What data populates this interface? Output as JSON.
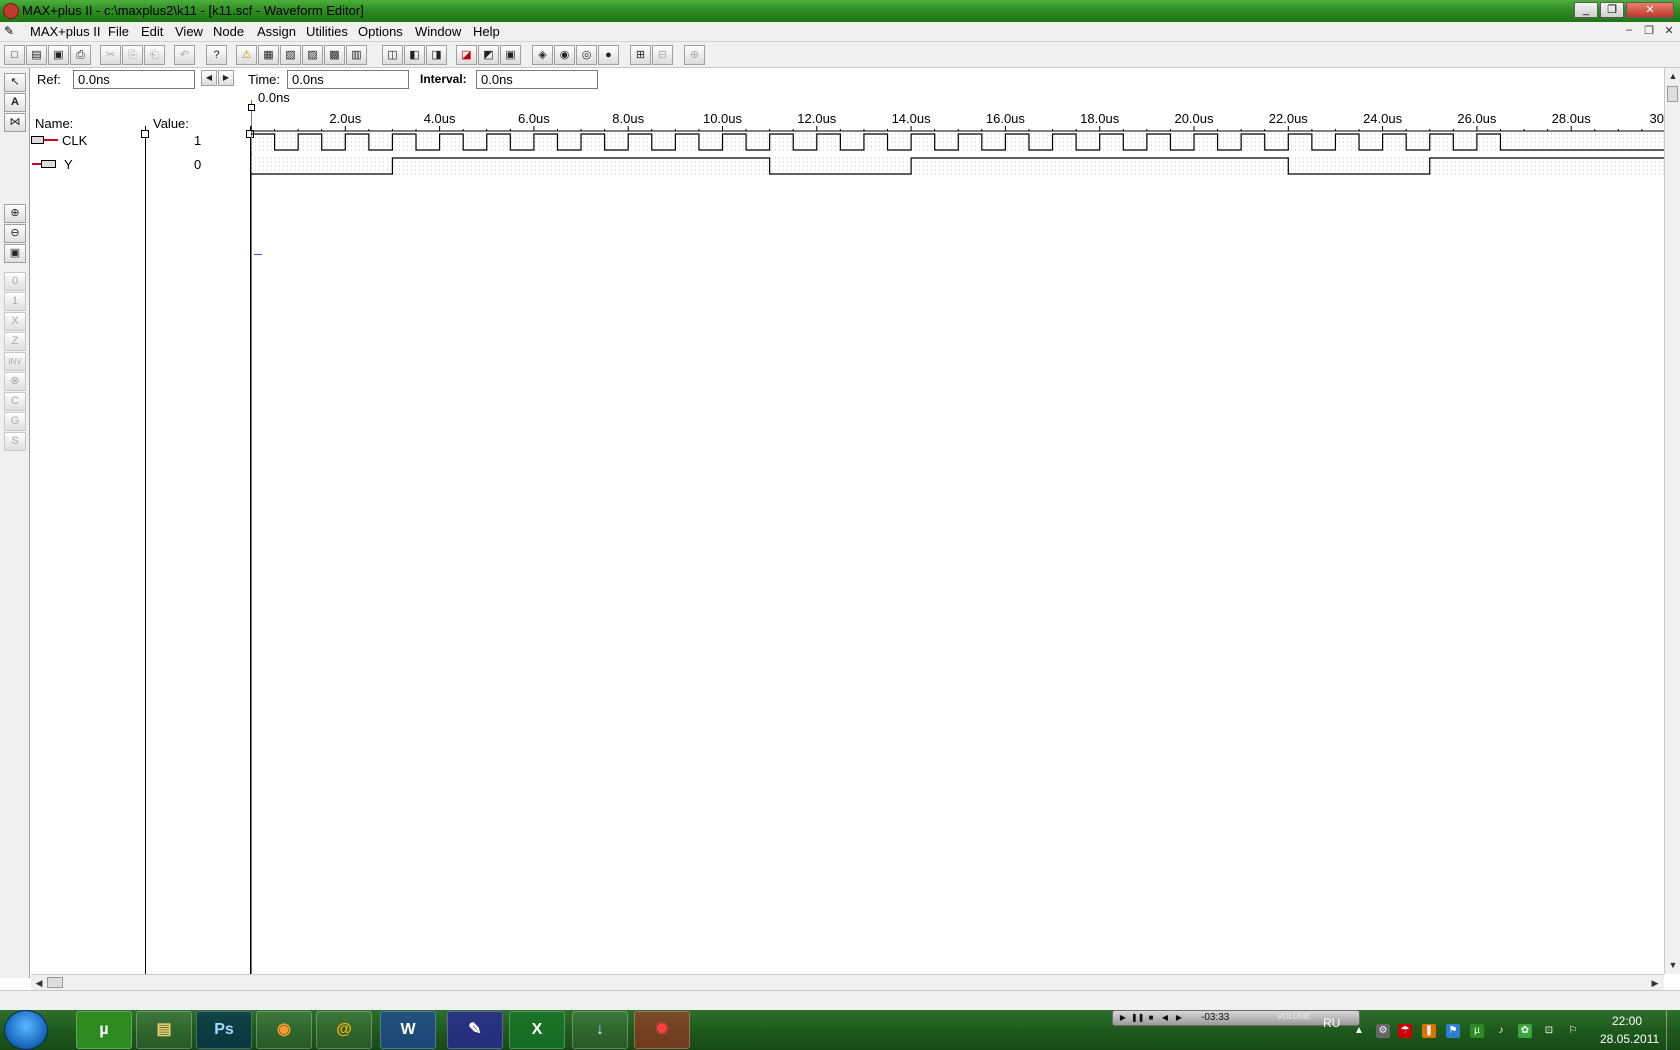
{
  "window": {
    "title": "MAX+plus II - c:\\maxplus2\\k11 - [k11.scf - Waveform Editor]",
    "min": "_",
    "restore": "❐",
    "close": "✕"
  },
  "menu": {
    "items": [
      "MAX+plus II",
      "File",
      "Edit",
      "View",
      "Node",
      "Assign",
      "Utilities",
      "Options",
      "Window",
      "Help"
    ],
    "mdi_min": "–",
    "mdi_restore": "❐",
    "mdi_close": "✕"
  },
  "toolbar": {
    "buttons": [
      "□",
      "▤",
      "▣",
      "⎙",
      "✂",
      "⎘",
      "⎗",
      "↶",
      "?",
      "⚠",
      "▦",
      "▧",
      "▨",
      "▩",
      "▥",
      "◫",
      "◧",
      "◨",
      "◪",
      "◩",
      "▣",
      "◈",
      "◉",
      "◎",
      "●",
      "⊞",
      "⊟",
      "⊕"
    ]
  },
  "header": {
    "ref_label": "Ref:",
    "ref_value": "0.0ns",
    "time_label": "Time:",
    "time_value": "0.0ns",
    "interval_label": "Interval:",
    "interval_value": "0.0ns",
    "nav_prev": "◀",
    "nav_next": "▶"
  },
  "columns": {
    "name": "Name:",
    "value": "Value:"
  },
  "cursor_time": "0.0ns",
  "timeline": {
    "unit_label_suffix": "us",
    "ticks": [
      "2.0us",
      "4.0us",
      "6.0us",
      "8.0us",
      "10.0us",
      "12.0us",
      "14.0us",
      "16.0us",
      "18.0us",
      "20.0us",
      "22.0us",
      "24.0us",
      "26.0us",
      "28.0us",
      "30."
    ],
    "tick_values_us": [
      2,
      4,
      6,
      8,
      10,
      12,
      14,
      16,
      18,
      20,
      22,
      24,
      26,
      28,
      30
    ],
    "visible_range_us": [
      0,
      30
    ]
  },
  "signals": [
    {
      "name": "CLK",
      "value": "1",
      "icon": "input-pin-icon",
      "period_us": 1,
      "clock_end_us": 26.5,
      "transitions_us": []
    },
    {
      "name": "Y",
      "value": "0",
      "icon": "output-pin-icon",
      "transitions_us": [
        3.0,
        11.0,
        14.0,
        22.0,
        25.0
      ],
      "initial": 0
    }
  ],
  "left_tools": [
    "↖",
    "A",
    "⋈",
    "⊕",
    "⊖",
    "▣",
    "0",
    "1",
    "X",
    "Z",
    "INV",
    "⊗",
    "C",
    "G",
    "S"
  ],
  "taskbar": {
    "apps": [
      "µ",
      "▤",
      "Ps",
      "◉",
      "@",
      "W",
      "✎",
      "X",
      "↓",
      "✹"
    ],
    "lang": "RU",
    "time": "22:00",
    "date": "28.05.2011",
    "media_time": "-03:33",
    "media_volume": "VOLUME"
  },
  "colors": {
    "titlebar": "#2f8e22",
    "taskbar": "#1f5a1d",
    "waveform": "#000000",
    "grid": "#b8b8b8",
    "pin": "#d0021b"
  }
}
